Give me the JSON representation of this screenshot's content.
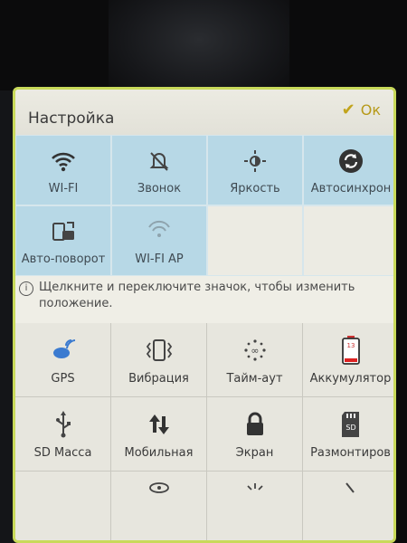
{
  "header": {
    "title": "Настройка",
    "ok_label": "Ок"
  },
  "quick_tiles": [
    {
      "label": "WI-FI",
      "state": "on",
      "icon": "wifi-icon"
    },
    {
      "label": "Звонок",
      "state": "on",
      "icon": "bell-muted-icon"
    },
    {
      "label": "Яркость",
      "state": "on",
      "icon": "brightness-icon"
    },
    {
      "label": "Автосинхрон",
      "state": "on",
      "icon": "sync-icon"
    },
    {
      "label": "Авто-поворот",
      "state": "on",
      "icon": "rotate-icon"
    },
    {
      "label": "WI-FI AP",
      "state": "on",
      "icon": "hotspot-icon"
    }
  ],
  "hint": "Щелкните и переключите значок, чтобы изменить положение.",
  "more_tiles": [
    {
      "label": "GPS",
      "icon": "gps-icon"
    },
    {
      "label": "Вибрация",
      "icon": "vibration-icon"
    },
    {
      "label": "Тайм-аут",
      "icon": "timeout-icon"
    },
    {
      "label": "Аккумулятор",
      "icon": "battery-icon",
      "badge": "13"
    },
    {
      "label": "SD Масса",
      "icon": "usb-icon"
    },
    {
      "label": "Мобильная",
      "icon": "mobile-data-icon"
    },
    {
      "label": "Экран",
      "icon": "lock-icon"
    },
    {
      "label": "Размонтиров",
      "icon": "sd-card-icon",
      "badge": "SD"
    }
  ],
  "colors": {
    "tile_on": "#b7d8e6",
    "accent": "#c2a41c",
    "panel_border": "#c8d95a"
  }
}
